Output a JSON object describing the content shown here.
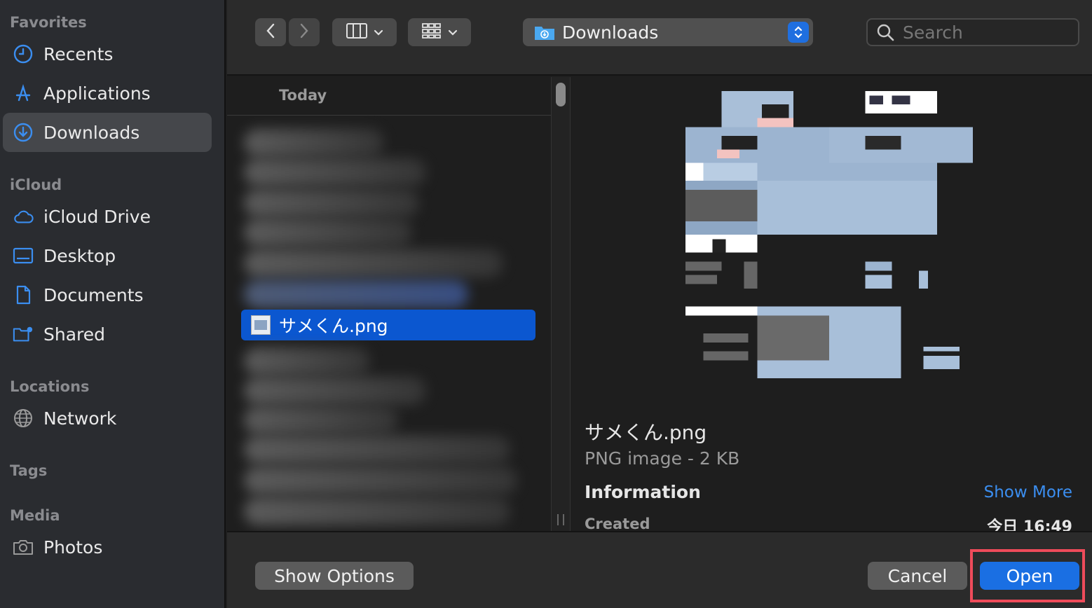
{
  "sidebar": {
    "sections": {
      "favorites": "Favorites",
      "icloud": "iCloud",
      "locations": "Locations",
      "tags": "Tags",
      "media": "Media"
    },
    "items": {
      "recents": "Recents",
      "applications": "Applications",
      "downloads": "Downloads",
      "icloud_drive": "iCloud Drive",
      "desktop": "Desktop",
      "documents": "Documents",
      "shared": "Shared",
      "network": "Network",
      "photos": "Photos"
    },
    "active": "downloads"
  },
  "toolbar": {
    "current_folder": "Downloads",
    "search_placeholder": "Search"
  },
  "filelist": {
    "column_header": "Today",
    "selected_file": "サメくん.png"
  },
  "preview": {
    "file_name": "サメくん.png",
    "file_kind": "PNG image - 2 KB",
    "info_heading": "Information",
    "show_more": "Show More",
    "created_label": "Created",
    "created_value": "今日 16:49"
  },
  "buttons": {
    "show_options": "Show Options",
    "cancel": "Cancel",
    "open": "Open"
  },
  "colors": {
    "accent": "#1a6fe3",
    "selection": "#0b57d0",
    "highlight_box": "#ef4b5a",
    "sidebar_icon": "#3b8ef0"
  }
}
